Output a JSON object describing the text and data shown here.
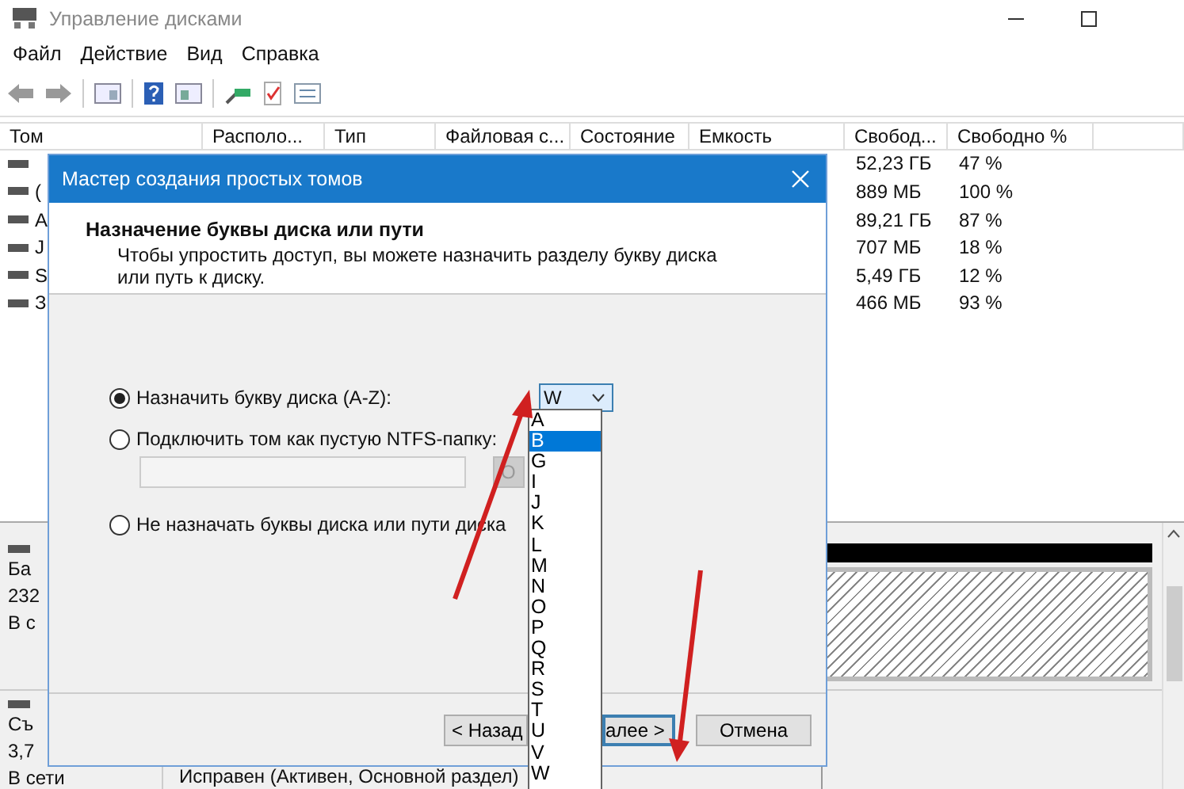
{
  "window": {
    "title": "Управление дисками"
  },
  "menu": [
    "Файл",
    "Действие",
    "Вид",
    "Справка"
  ],
  "table": {
    "columns": [
      "Том",
      "Располо...",
      "Тип",
      "Файловая с...",
      "Состояние",
      "Емкость",
      "Свобод...",
      "Свободно %"
    ],
    "rows": [
      {
        "free": "52,23 ГБ",
        "free_pct": "47 %"
      },
      {
        "volume": "(",
        "free": "889 МБ",
        "free_pct": "100 %"
      },
      {
        "volume": "А",
        "free": "89,21 ГБ",
        "free_pct": "87 %"
      },
      {
        "volume": "J",
        "free": "707 МБ",
        "free_pct": "18 %"
      },
      {
        "volume": "S",
        "free": "5,49 ГБ",
        "free_pct": "12 %"
      },
      {
        "volume": "З",
        "free": "466 МБ",
        "free_pct": "93 %"
      }
    ]
  },
  "disks": [
    {
      "lines": [
        "Ба",
        "232",
        "В с"
      ]
    },
    {
      "lines": [
        "Съ",
        "3,7",
        "В сети"
      ],
      "status": "Исправен (Активен, Основной раздел)"
    }
  ],
  "dialog": {
    "title": "Мастер создания простых томов",
    "heading": "Назначение буквы диска или пути",
    "description": "Чтобы упростить доступ, вы можете назначить разделу букву диска или путь к диску.",
    "options": [
      {
        "kind": "letter",
        "label": "Назначить букву диска (A-Z):",
        "selected": true
      },
      {
        "kind": "folder",
        "label": "Подключить том как пустую NTFS-папку:",
        "selected": false
      },
      {
        "kind": "none",
        "label": "Не назначать буквы диска или пути диска",
        "selected": false
      }
    ],
    "browse_button": "О",
    "letter_select": {
      "value": "W",
      "expanded": true,
      "items": [
        {
          "label": "A",
          "highlighted": false
        },
        {
          "label": "B",
          "highlighted": true
        },
        {
          "label": "G",
          "highlighted": false
        },
        {
          "label": "I",
          "highlighted": false
        },
        {
          "label": "J",
          "highlighted": false
        },
        {
          "label": "K",
          "highlighted": false
        },
        {
          "label": "L",
          "highlighted": false
        },
        {
          "label": "M",
          "highlighted": false
        },
        {
          "label": "N",
          "highlighted": false
        },
        {
          "label": "O",
          "highlighted": false
        },
        {
          "label": "P",
          "highlighted": false
        },
        {
          "label": "Q",
          "highlighted": false
        },
        {
          "label": "R",
          "highlighted": false
        },
        {
          "label": "S",
          "highlighted": false
        },
        {
          "label": "T",
          "highlighted": false
        },
        {
          "label": "U",
          "highlighted": false
        },
        {
          "label": "V",
          "highlighted": false
        },
        {
          "label": "W",
          "highlighted": false
        }
      ]
    },
    "buttons": [
      {
        "kind": "back",
        "label": "< Назад",
        "focused": false
      },
      {
        "kind": "next",
        "label": "алее >",
        "focused": true
      },
      {
        "kind": "cancel",
        "label": "Отмена",
        "focused": false
      }
    ]
  }
}
